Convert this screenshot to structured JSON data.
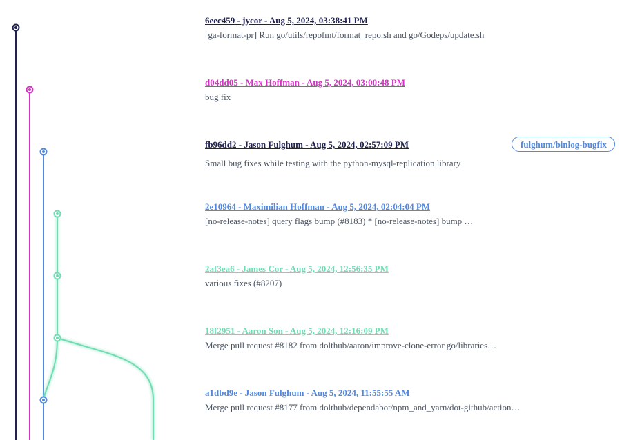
{
  "colors": {
    "navy": "#1f2150",
    "pink": "#d633c4",
    "blue": "#5288dd",
    "green": "#6fdcb2"
  },
  "commits": [
    {
      "title": "6eec459 - jycor - Aug 5, 2024, 03:38:41 PM",
      "message": "[ga-format-pr] Run go/utils/repofmt/format_repo.sh and go/Godeps/update.sh",
      "color": "navy"
    },
    {
      "title": "d04dd05 - Max Hoffman - Aug 5, 2024, 03:00:48 PM",
      "message": "bug fix",
      "color": "pink"
    },
    {
      "title": "fb96dd2 - Jason Fulghum - Aug 5, 2024, 02:57:09 PM",
      "message": "Small bug fixes while testing with the python-mysql-replication library",
      "color": "blue",
      "branch": "fulghum/binlog-bugfix"
    },
    {
      "title": "2e10964 - Maximilian Hoffman - Aug 5, 2024, 02:04:04 PM",
      "message": "[no-release-notes] query flags bump (#8183) * [no-release-notes] bump …",
      "color": "blue"
    },
    {
      "title": "2af3ea6 - James Cor - Aug 5, 2024, 12:56:35 PM",
      "message": "various fixes (#8207)",
      "color": "green"
    },
    {
      "title": "18f2951 - Aaron Son - Aug 5, 2024, 12:16:09 PM",
      "message": "Merge pull request #8182 from dolthub/aaron/improve-clone-error go/libraries…",
      "color": "green"
    },
    {
      "title": "a1dbd9e - Jason Fulghum - Aug 5, 2024, 11:55:55 AM",
      "message": "Merge pull request #8177 from dolthub/dependabot/npm_and_yarn/dot-github/action…",
      "color": "blue"
    }
  ]
}
